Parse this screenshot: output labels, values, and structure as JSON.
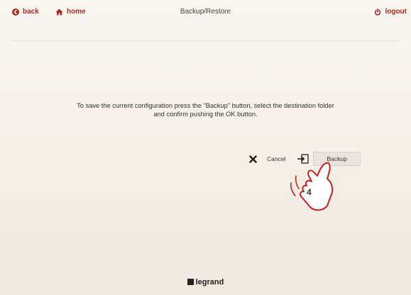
{
  "header": {
    "back_label": "back",
    "home_label": "home",
    "title": "Backup/Restore",
    "logout_label": "logout"
  },
  "main": {
    "message_line1": "To save the current configuration press the \"Backup\" button, select the destination folder",
    "message_line2": "and confirm pushing the OK button."
  },
  "actions": {
    "cancel_label": "Cancel",
    "backup_label": "Backup",
    "callout_number": "4"
  },
  "footer": {
    "brand": "legrand"
  },
  "colors": {
    "accent": "#b22a22",
    "background": "#f6f2ec",
    "text": "#333333"
  },
  "icons": [
    "back-arrow-icon",
    "home-icon",
    "power-icon",
    "cancel-x-icon",
    "backup-icon",
    "pointing-hand-icon"
  ]
}
